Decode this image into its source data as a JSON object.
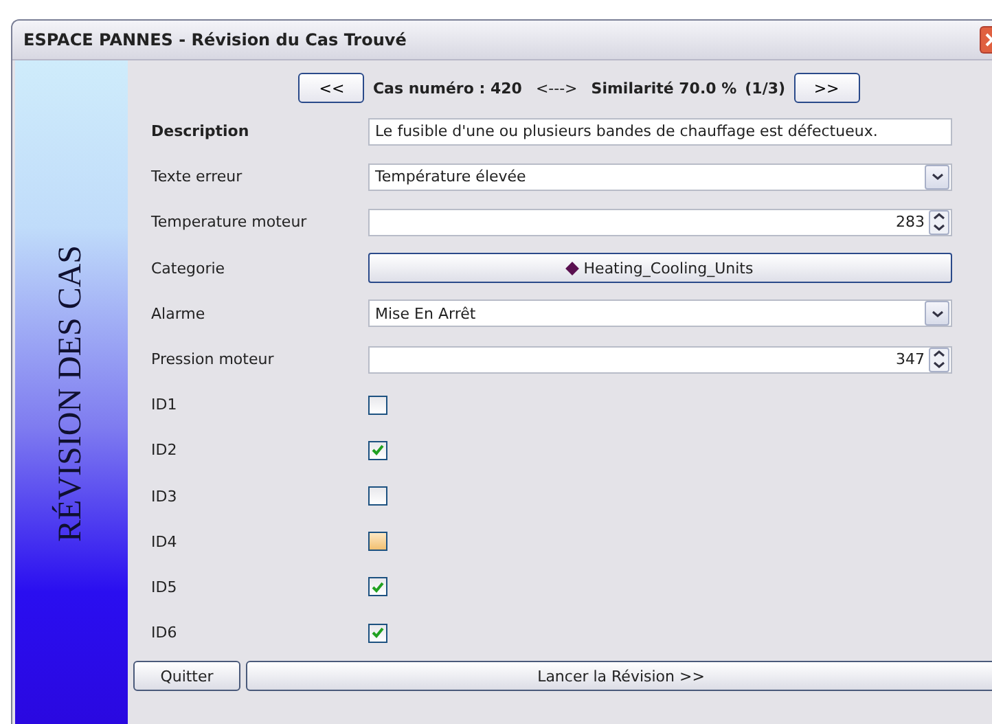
{
  "window": {
    "title": "ESPACE PANNES - Révision du Cas Trouvé"
  },
  "sidebar": {
    "title": "RÉVISION DES CAS"
  },
  "navigation": {
    "previous": "<<",
    "case": "Cas numéro : 420",
    "separator": "<--->",
    "similarity": "Similarité 70.0 %",
    "position": "(1/3)",
    "next": ">>"
  },
  "fields": [
    {
      "kind": "text",
      "label": "Description",
      "bold": true,
      "value": "Le fusible d'une ou plusieurs bandes de chauffage est défectueux."
    },
    {
      "kind": "combo",
      "label": "Texte erreur",
      "bold": false,
      "value": "Température élevée"
    },
    {
      "kind": "spin",
      "label": "Temperature moteur",
      "bold": false,
      "value": "283"
    },
    {
      "kind": "button",
      "label": "Categorie",
      "bold": false,
      "value": "Heating_Cooling_Units"
    },
    {
      "kind": "combo",
      "label": "Alarme",
      "bold": false,
      "value": "Mise En Arrêt"
    },
    {
      "kind": "spin",
      "label": "Pression moteur",
      "bold": false,
      "value": "347"
    },
    {
      "kind": "checkbox",
      "label": "ID1",
      "bold": false,
      "checked": false,
      "highlighted": false
    },
    {
      "kind": "checkbox",
      "label": "ID2",
      "bold": false,
      "checked": true,
      "highlighted": false
    },
    {
      "kind": "checkbox",
      "label": "ID3",
      "bold": false,
      "checked": false,
      "highlighted": false
    },
    {
      "kind": "checkbox",
      "label": "ID4",
      "bold": false,
      "checked": false,
      "highlighted": true
    },
    {
      "kind": "checkbox",
      "label": "ID5",
      "bold": false,
      "checked": true,
      "highlighted": false
    },
    {
      "kind": "checkbox",
      "label": "ID6",
      "bold": false,
      "checked": true,
      "highlighted": false
    }
  ],
  "buttons": {
    "quit": "Quitter",
    "start": "Lancer la Révision >>"
  }
}
